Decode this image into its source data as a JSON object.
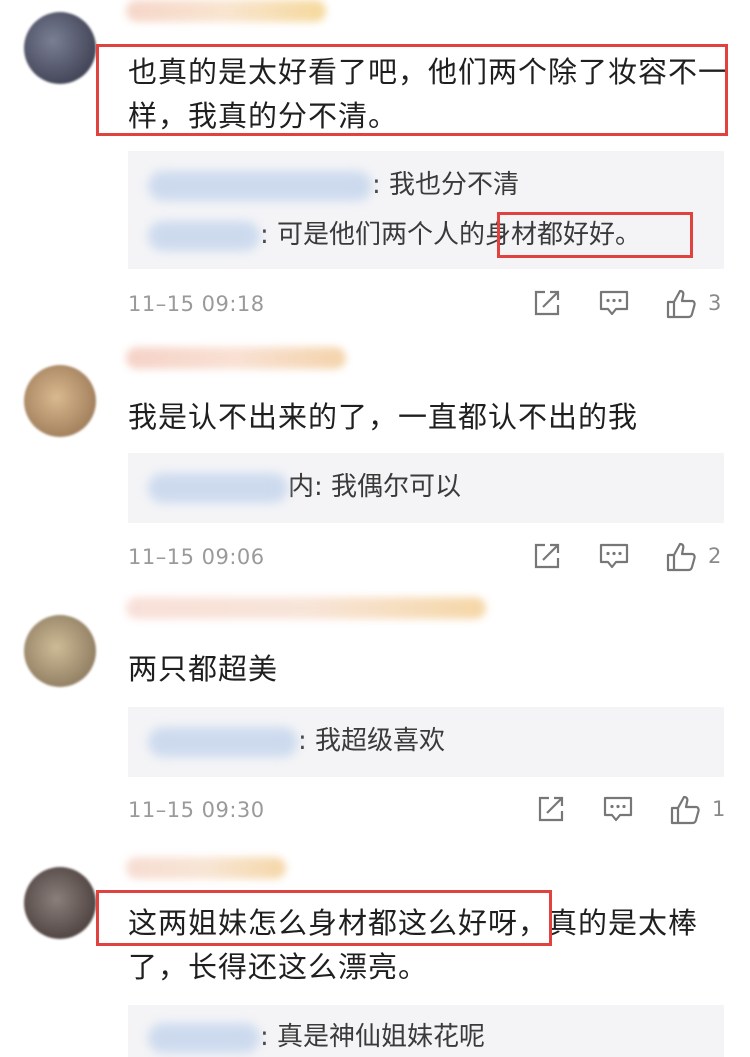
{
  "comments": [
    {
      "text": "也真的是太好看了吧，他们两个除了妆容不一样，我真的分不清。",
      "replies": [
        {
          "sep": ":",
          "text": " 我也分不清"
        },
        {
          "sep": ":",
          "text": " 可是他们两个人的身材都好好。"
        }
      ],
      "time": "11–15 09:18",
      "likes": "3"
    },
    {
      "text": "我是认不出来的了，一直都认不出的我",
      "replies": [
        {
          "sep": "内:",
          "text": " 我偶尔可以"
        }
      ],
      "time": "11–15 09:06",
      "likes": "2"
    },
    {
      "text": "两只都超美",
      "replies": [
        {
          "sep": ":",
          "text": " 我超级喜欢"
        }
      ],
      "time": "11–15 09:30",
      "likes": "1"
    },
    {
      "text": "这两姐妹怎么身材都这么好呀，真的是太棒了，长得还这么漂亮。",
      "replies": [
        {
          "sep": ":",
          "text": " 真是神仙姐妹花呢"
        }
      ]
    }
  ],
  "icons": {
    "share": "share-icon",
    "comment": "comment-icon",
    "like": "thumbs-up-icon"
  },
  "colors": {
    "highlight": "#e0423f",
    "reply_bg": "#f4f4f6",
    "meta": "#9a9a9a"
  }
}
